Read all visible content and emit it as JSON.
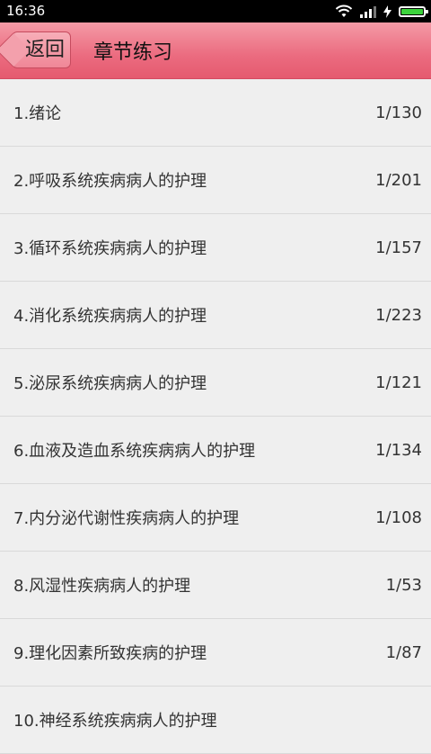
{
  "status_bar": {
    "time": "16:36",
    "battery_level": 1.0,
    "accent_color": "#3cd33c"
  },
  "header": {
    "back_label": "返回",
    "title": "章节练习",
    "brand_color": "#eb6b7f"
  },
  "chapters": [
    {
      "label": "1.绪论",
      "count": "1/130"
    },
    {
      "label": "2.呼吸系统疾病病人的护理",
      "count": "1/201"
    },
    {
      "label": "3.循环系统疾病病人的护理",
      "count": "1/157"
    },
    {
      "label": "4.消化系统疾病病人的护理",
      "count": "1/223"
    },
    {
      "label": "5.泌尿系统疾病病人的护理",
      "count": "1/121"
    },
    {
      "label": "6.血液及造血系统疾病病人的护理",
      "count": "1/134"
    },
    {
      "label": "7.内分泌代谢性疾病病人的护理",
      "count": "1/108"
    },
    {
      "label": "8.风湿性疾病病人的护理",
      "count": "1/53"
    },
    {
      "label": "9.理化因素所致疾病的护理",
      "count": "1/87"
    },
    {
      "label": "10.神经系统疾病病人的护理",
      "count": ""
    }
  ]
}
